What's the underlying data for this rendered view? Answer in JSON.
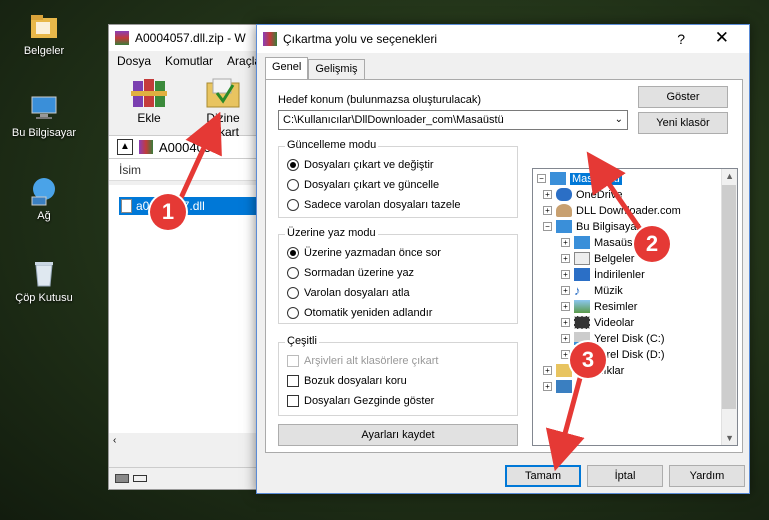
{
  "desktop": {
    "icons": [
      {
        "label": "Belgeler",
        "icon": "folder-icon"
      },
      {
        "label": "Bu Bilgisayar",
        "icon": "computer-icon"
      },
      {
        "label": "Ağ",
        "icon": "network-icon"
      },
      {
        "label": "Çöp Kutusu",
        "icon": "recycle-bin-icon"
      }
    ]
  },
  "winrar": {
    "title": "A0004057.dll.zip - W",
    "menu": [
      "Dosya",
      "Komutlar",
      "Araçla"
    ],
    "toolbar": {
      "add_label": "Ekle",
      "extract_label": "Dizine Çıkart"
    },
    "path": "A0004057",
    "column_name": "İsim",
    "file_name": "a0004057.dll"
  },
  "dialog": {
    "title": "Çıkartma yolu ve seçenekleri",
    "help_glyph": "?",
    "close_glyph": "✕",
    "tabs": [
      "Genel",
      "Gelişmiş"
    ],
    "destination_label": "Hedef konum (bulunmazsa oluşturulacak)",
    "destination_value": "C:\\Kullanıcılar\\DllDownloader_com\\Masaüstü",
    "show_button": "Göster",
    "new_folder_button": "Yeni klasör",
    "update_mode": {
      "title": "Güncelleme modu",
      "options": [
        "Dosyaları çıkart ve değiştir",
        "Dosyaları çıkart ve güncelle",
        "Sadece varolan dosyaları tazele"
      ],
      "selected": 0
    },
    "overwrite_mode": {
      "title": "Üzerine yaz modu",
      "options": [
        "Üzerine yazmadan önce sor",
        "Sormadan üzerine yaz",
        "Varolan dosyaları atla",
        "Otomatik yeniden adlandır"
      ],
      "selected": 0
    },
    "misc": {
      "title": "Çeşitli",
      "options": [
        "Arşivleri alt klasörlere çıkart",
        "Bozuk dosyaları koru",
        "Dosyaları Gezginde göster"
      ],
      "disabled": [
        true,
        false,
        false
      ],
      "checked": [
        false,
        false,
        false
      ]
    },
    "save_settings_button": "Ayarları kaydet",
    "tree": [
      {
        "label": "Masaüstü",
        "selected": true
      },
      {
        "label": "OneDrive"
      },
      {
        "label": "DLL Downloader.com"
      },
      {
        "label": "Bu Bilgisayar"
      },
      {
        "label": "Masaüstü"
      },
      {
        "label": "Belgeler"
      },
      {
        "label": "İndirilenler"
      },
      {
        "label": "Müzik"
      },
      {
        "label": "Resimler"
      },
      {
        "label": "Videolar"
      },
      {
        "label": "Yerel Disk (C:)"
      },
      {
        "label": "Yerel Disk (D:)"
      },
      {
        "label": "Kitaplıklar"
      },
      {
        "label": ""
      }
    ],
    "ok_button": "Tamam",
    "cancel_button": "İptal",
    "help_button": "Yardım"
  },
  "callouts": [
    "1",
    "2",
    "3"
  ],
  "colors": {
    "accent": "#0078d7",
    "callout": "#e53935"
  }
}
